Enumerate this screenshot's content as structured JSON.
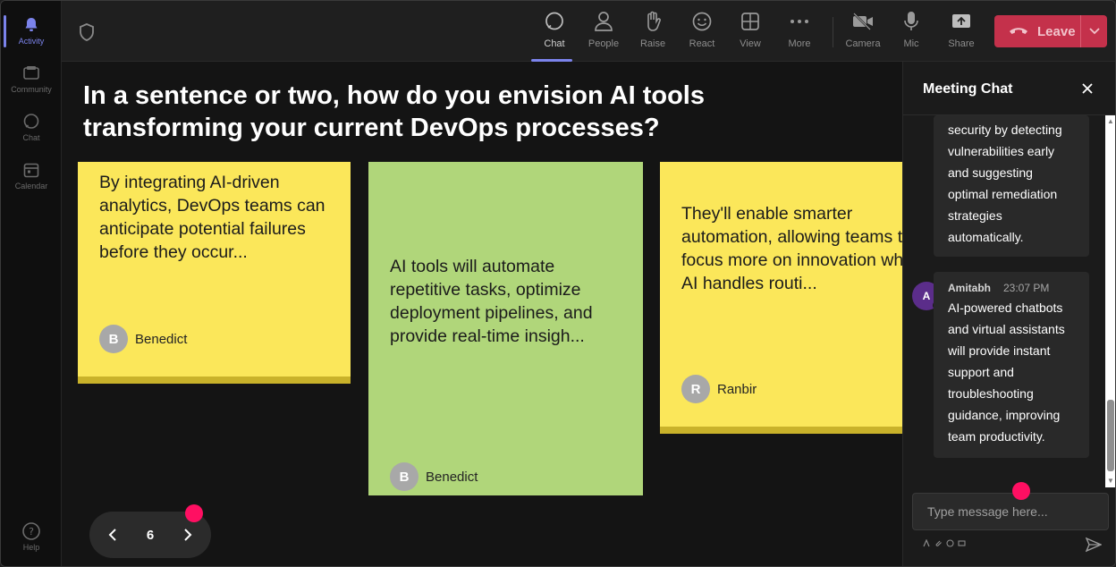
{
  "rail": {
    "items": [
      {
        "label": "Activity",
        "icon": "bell-icon"
      },
      {
        "label": "Community",
        "icon": "community-icon"
      },
      {
        "label": "Chat",
        "icon": "chat-icon"
      },
      {
        "label": "Calendar",
        "icon": "calendar-icon"
      }
    ],
    "help_label": "Help"
  },
  "topbar": {
    "buttons": [
      {
        "label": "Chat",
        "icon": "chat-icon"
      },
      {
        "label": "People",
        "icon": "people-icon"
      },
      {
        "label": "Raise",
        "icon": "hand-icon"
      },
      {
        "label": "React",
        "icon": "smiley-icon"
      },
      {
        "label": "View",
        "icon": "grid-icon"
      },
      {
        "label": "More",
        "icon": "more-icon"
      },
      {
        "label": "Camera",
        "icon": "camera-off-icon"
      },
      {
        "label": "Mic",
        "icon": "mic-icon"
      },
      {
        "label": "Share",
        "icon": "share-icon"
      }
    ],
    "leave_label": "Leave"
  },
  "stage": {
    "question": "In a sentence or two, how do you envision AI tools transforming your current DevOps processes?",
    "notes": [
      {
        "text": "By integrating AI-driven analytics, DevOps teams can anticipate potential failures before they occur...",
        "initial": "B",
        "author": "Benedict"
      },
      {
        "text": "AI tools will automate repetitive tasks, optimize deployment pipelines, and provide real-time insigh...",
        "initial": "B",
        "author": "Benedict"
      },
      {
        "text": "They'll enable smarter automation, allowing teams to focus more on innovation while AI handles routi...",
        "initial": "R",
        "author": "Ranbir"
      }
    ],
    "pager": {
      "page": "6"
    }
  },
  "chat": {
    "title": "Meeting Chat",
    "messages": [
      {
        "text": "security by detecting vulnerabilities early and suggesting optimal remediation strategies automatically."
      },
      {
        "initial": "A",
        "author": "Amitabh",
        "time": "23:07 PM",
        "text": "AI-powered chatbots and virtual assistants will provide instant support and troubleshooting guidance, improving team productivity."
      }
    ],
    "placeholder": "Type message here..."
  },
  "colors": {
    "accent": "#7b83eb",
    "leave": "#c4314b",
    "note_yellow": "#fbe75a",
    "note_green": "#b0d67a",
    "pink_marker": "#ff0f62",
    "chat_avatar": "#5b2d8a"
  }
}
